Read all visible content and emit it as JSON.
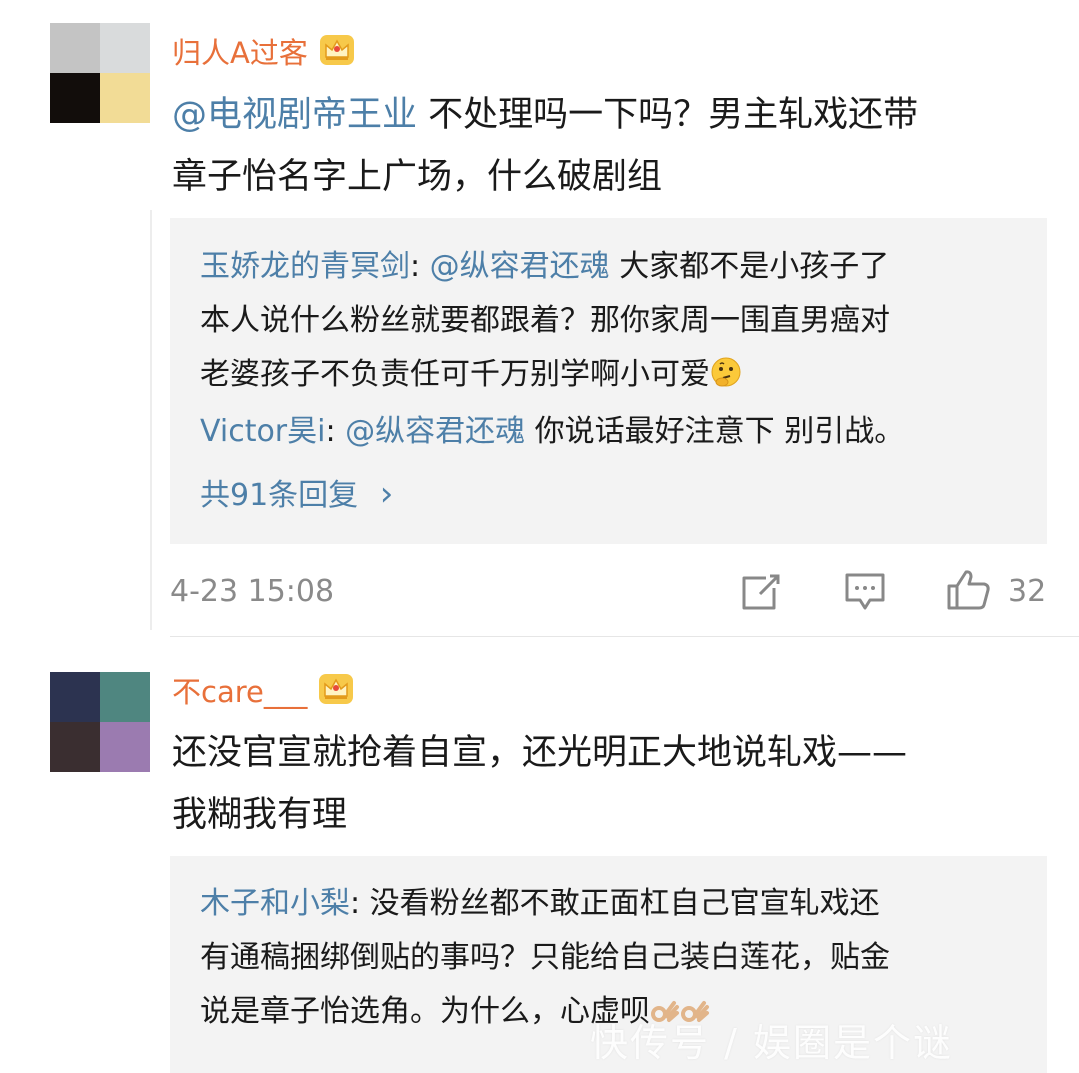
{
  "comments": [
    {
      "username": "归人A过客",
      "mention": "@电视剧帝王业",
      "text_line1": " 不处理吗一下吗？男主轧戏还带",
      "text_line2": "章子怡名字上广场，什么破剧组",
      "avatar_colors": [
        "#c4c4c4",
        "#d9dbdc",
        "#120d0b",
        "#f2dc96"
      ],
      "replies": [
        {
          "name": "玉娇龙的青冥剑",
          "colon": ": ",
          "mention": "@纵容君还魂",
          "line1": " 大家都不是小孩子了",
          "line2": "本人说什么粉丝就要都跟着？那你家周一围直男癌对",
          "line3": "老婆孩子不负责任可千万别学啊小可爱"
        },
        {
          "name": "Victor昊i",
          "colon": ": ",
          "mention": "@纵容君还魂",
          "line1": " 你说话最好注意下 别引战。"
        }
      ],
      "more_replies": "共91条回复",
      "more_chevron": "›",
      "timestamp": "4-23 15:08",
      "likes": "32"
    },
    {
      "username": "不care___",
      "text_line1": "还没官宣就抢着自宣，还光明正大地说轧戏——",
      "text_line2": "我糊我有理",
      "avatar_colors": [
        "#2c3350",
        "#4f8680",
        "#3a2e30",
        "#9b7bb0"
      ],
      "replies": [
        {
          "name": "木子和小梨",
          "colon": ": ",
          "line1": "没看粉丝都不敢正面杠自己官宣轧戏还",
          "line2": "有通稿捆绑倒贴的事吗？只能给自己装白莲花，贴金",
          "line3": "说是章子怡选角。为什么，心虚呗"
        }
      ]
    }
  ],
  "icons": {
    "crown": "crown-badge-icon",
    "thinking": "thinking-face-emoji",
    "ok_hand": "ok-hand-emoji",
    "share": "share-icon",
    "comment": "comment-icon",
    "like": "thumbs-up-icon"
  },
  "colors": {
    "username": "#e8703a",
    "link": "#4d7fa8",
    "reply_bg": "#f3f3f3",
    "meta": "#8a8a8a"
  },
  "watermark": "快传号 / 娱圈是个谜"
}
